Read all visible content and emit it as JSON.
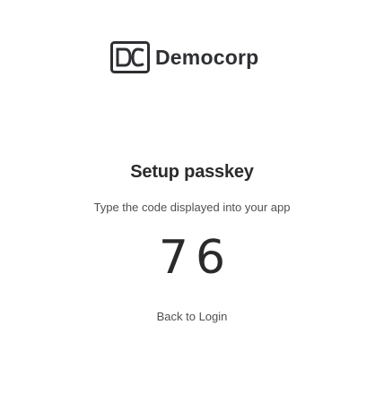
{
  "brand": {
    "logo_icon": "democorp-logo-icon",
    "logo_text": "DC",
    "name": "Democorp",
    "color": "#2f3033"
  },
  "passkey": {
    "heading": "Setup passkey",
    "instruction": "Type the code displayed into your app",
    "code": "76"
  },
  "links": {
    "back_to_login": "Back to Login"
  }
}
